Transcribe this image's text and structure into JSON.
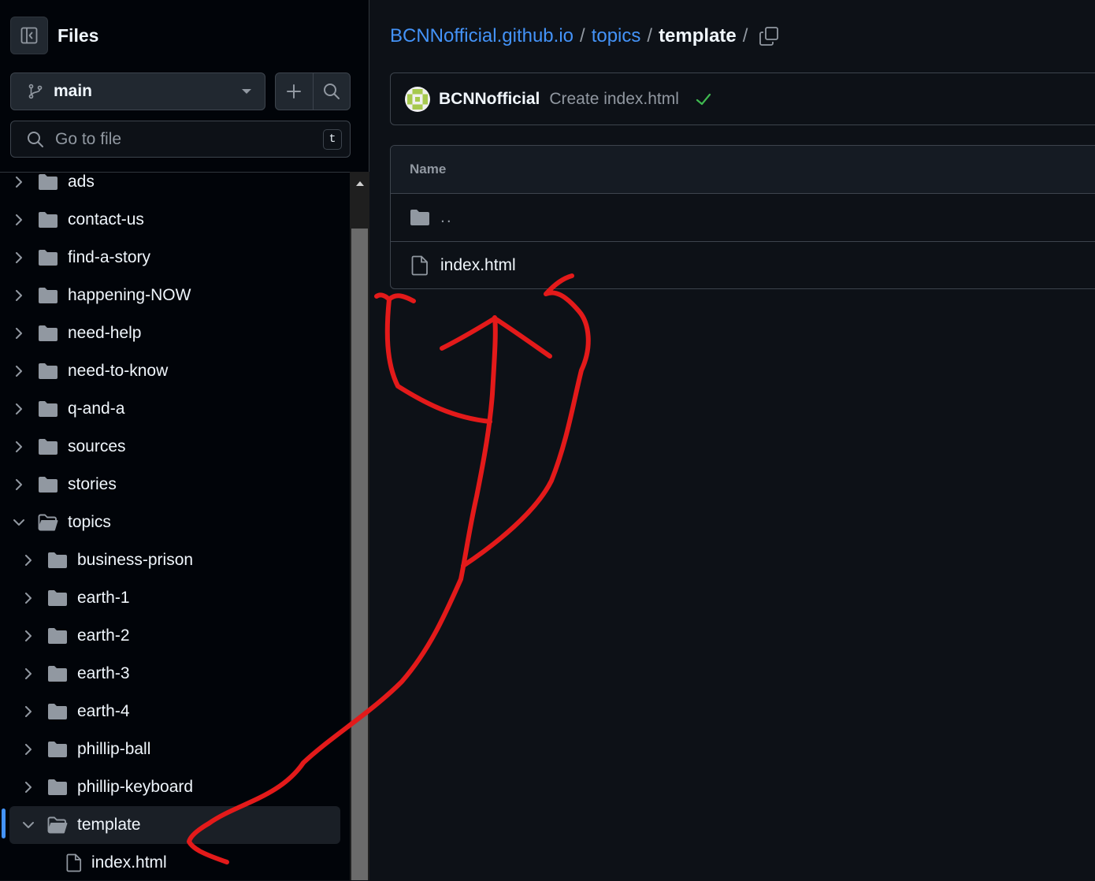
{
  "sidebar": {
    "title": "Files",
    "toggle_icon": "sidebar-collapse-icon",
    "branch": {
      "label": "main",
      "icon": "git-branch-icon"
    },
    "add_icon": "plus-icon",
    "search_icon": "search-icon",
    "goto": {
      "placeholder": "Go to file",
      "shortcut": "t"
    },
    "tree": [
      {
        "name": "ads",
        "depth": 0,
        "kind": "folder",
        "expanded": false
      },
      {
        "name": "contact-us",
        "depth": 0,
        "kind": "folder",
        "expanded": false
      },
      {
        "name": "find-a-story",
        "depth": 0,
        "kind": "folder",
        "expanded": false
      },
      {
        "name": "happening-NOW",
        "depth": 0,
        "kind": "folder",
        "expanded": false
      },
      {
        "name": "need-help",
        "depth": 0,
        "kind": "folder",
        "expanded": false
      },
      {
        "name": "need-to-know",
        "depth": 0,
        "kind": "folder",
        "expanded": false
      },
      {
        "name": "q-and-a",
        "depth": 0,
        "kind": "folder",
        "expanded": false
      },
      {
        "name": "sources",
        "depth": 0,
        "kind": "folder",
        "expanded": false
      },
      {
        "name": "stories",
        "depth": 0,
        "kind": "folder",
        "expanded": false
      },
      {
        "name": "topics",
        "depth": 0,
        "kind": "folder",
        "expanded": true
      },
      {
        "name": "business-prison",
        "depth": 1,
        "kind": "folder",
        "expanded": false
      },
      {
        "name": "earth-1",
        "depth": 1,
        "kind": "folder",
        "expanded": false
      },
      {
        "name": "earth-2",
        "depth": 1,
        "kind": "folder",
        "expanded": false
      },
      {
        "name": "earth-3",
        "depth": 1,
        "kind": "folder",
        "expanded": false
      },
      {
        "name": "earth-4",
        "depth": 1,
        "kind": "folder",
        "expanded": false
      },
      {
        "name": "phillip-ball",
        "depth": 1,
        "kind": "folder",
        "expanded": false
      },
      {
        "name": "phillip-keyboard",
        "depth": 1,
        "kind": "folder",
        "expanded": false
      },
      {
        "name": "template",
        "depth": 1,
        "kind": "folder",
        "expanded": true,
        "selected": true
      },
      {
        "name": "index.html",
        "depth": 2,
        "kind": "file"
      }
    ]
  },
  "breadcrumb": {
    "repo": "BCNNofficial.github.io",
    "folder": "topics",
    "current": "template",
    "separator": "/"
  },
  "commit": {
    "author": "BCNNofficial",
    "message": "Create index.html",
    "status": "success",
    "status_color": "#3fb950"
  },
  "file_table": {
    "header": "Name",
    "rows": [
      {
        "name": "..",
        "kind": "parent-folder"
      },
      {
        "name": "index.html",
        "kind": "file"
      }
    ]
  },
  "colors": {
    "accent": "#4493f8",
    "annotation": "#e31a1a",
    "background": "#0d1117",
    "sidebar_background": "#010409"
  }
}
